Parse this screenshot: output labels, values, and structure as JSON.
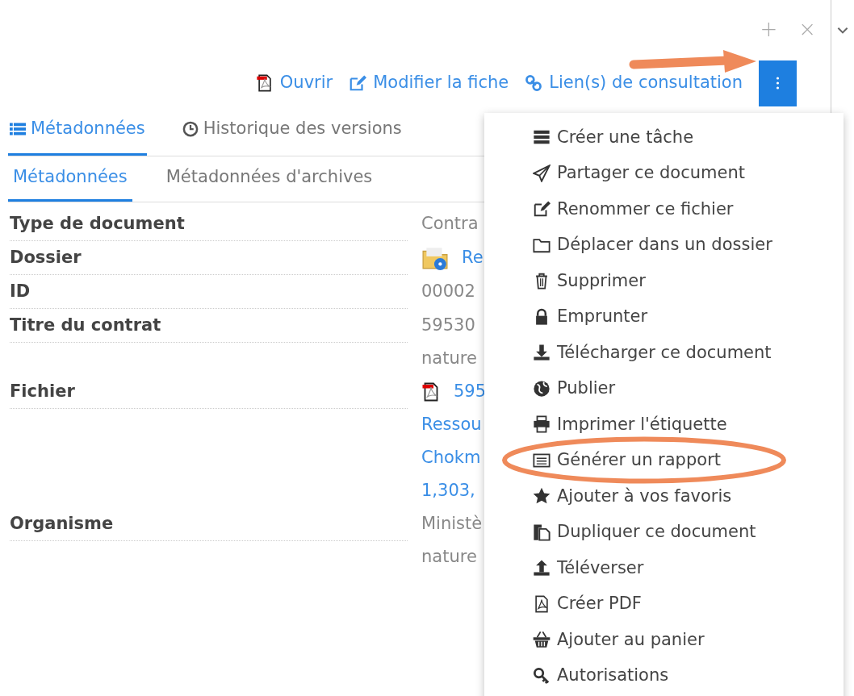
{
  "window_controls": {
    "add": "+",
    "close": "×"
  },
  "actions": [
    {
      "label": "Ouvrir"
    },
    {
      "label": "Modifier la fiche"
    },
    {
      "label": "Lien(s) de consultation"
    }
  ],
  "tabs": [
    {
      "label": "Métadonnées",
      "selected": true
    },
    {
      "label": "Historique des versions",
      "selected": false
    }
  ],
  "subtabs": [
    {
      "label": "Métadonnées",
      "selected": true
    },
    {
      "label": "Métadonnées d'archives",
      "selected": false
    }
  ],
  "fields": [
    {
      "label": "Type de document",
      "kind": "text",
      "lines": [
        "Contra"
      ]
    },
    {
      "label": "Dossier",
      "kind": "folder_link",
      "lines": [
        "Re"
      ]
    },
    {
      "label": "ID",
      "kind": "text",
      "lines": [
        "00002"
      ]
    },
    {
      "label": "Titre du contrat",
      "kind": "text",
      "lines": [
        "59530",
        "nature"
      ]
    },
    {
      "label": "Fichier",
      "kind": "file_link",
      "lines": [
        "595",
        "Ressou",
        "Chokm",
        "1,303,"
      ]
    },
    {
      "label": "Organisme",
      "kind": "text",
      "lines": [
        "Ministè",
        "nature"
      ]
    }
  ],
  "menu": {
    "items": [
      {
        "label": "Créer une tâche",
        "highlighted": false
      },
      {
        "label": "Partager ce document",
        "highlighted": false
      },
      {
        "label": "Renommer ce fichier",
        "highlighted": false
      },
      {
        "label": "Déplacer dans un dossier",
        "highlighted": false
      },
      {
        "label": "Supprimer",
        "highlighted": false
      },
      {
        "label": "Emprunter",
        "highlighted": false
      },
      {
        "label": "Télécharger ce document",
        "highlighted": false
      },
      {
        "label": "Publier",
        "highlighted": false
      },
      {
        "label": "Imprimer l'étiquette",
        "highlighted": false
      },
      {
        "label": "Générer un rapport",
        "highlighted": true
      },
      {
        "label": "Ajouter à vos favoris",
        "highlighted": false
      },
      {
        "label": "Dupliquer ce document",
        "highlighted": false
      },
      {
        "label": "Téléverser",
        "highlighted": false
      },
      {
        "label": "Créer PDF",
        "highlighted": false
      },
      {
        "label": "Ajouter au panier",
        "highlighted": false
      },
      {
        "label": "Autorisations",
        "highlighted": false
      }
    ]
  },
  "annotations": {
    "arrow": true
  }
}
